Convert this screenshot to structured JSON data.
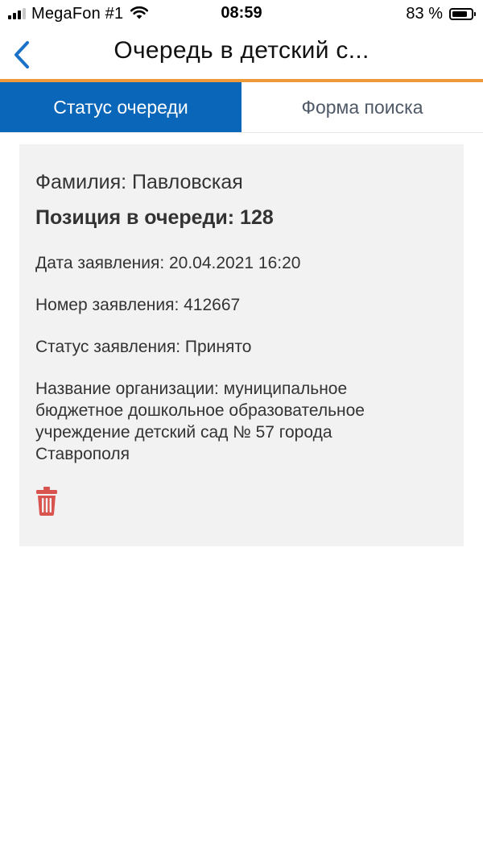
{
  "status_bar": {
    "carrier": "MegaFon #1",
    "time": "08:59",
    "battery_percent": "83 %",
    "battery_level": 0.83,
    "signal_bars_active": 3,
    "signal_bars_total": 4
  },
  "nav": {
    "title": "Очередь в детский с..."
  },
  "tabs": [
    {
      "label": "Статус очереди",
      "active": true
    },
    {
      "label": "Форма поиска",
      "active": false
    }
  ],
  "card": {
    "surname_line": "Фамилия: Павловская",
    "position_line": "Позиция в очереди: 128",
    "date_line": "Дата заявления: 20.04.2021 16:20",
    "number_line": "Номер заявления: 412667",
    "status_line": "Статус заявления: Принято",
    "org_line": "Название организации: муниципальное бюджетное дошкольное образовательное учреждение детский сад № 57 города Ставрополя"
  },
  "icons": {
    "back": "chevron-left-icon",
    "delete": "trash-icon",
    "wifi": "wifi-icon",
    "battery": "battery-icon",
    "signal": "cellular-signal-icon"
  },
  "colors": {
    "accent_blue": "#0a66b8",
    "back_arrow": "#1a73c8",
    "nav_divider_orange": "#ee9a3a",
    "delete_red": "#d9534f",
    "card_background": "#f2f2f2",
    "inactive_tab_text": "#4e5866"
  }
}
